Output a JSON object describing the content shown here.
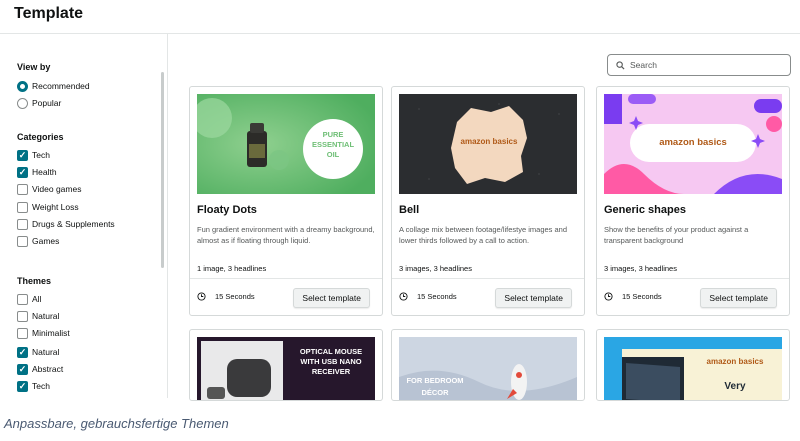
{
  "header": {
    "title": "Template"
  },
  "sidebar": {
    "view_by": {
      "heading": "View by",
      "options": [
        {
          "label": "Recommended",
          "selected": true
        },
        {
          "label": "Popular",
          "selected": false
        }
      ]
    },
    "categories": {
      "heading": "Categories",
      "items": [
        {
          "label": "Tech",
          "checked": true
        },
        {
          "label": "Health",
          "checked": true
        },
        {
          "label": "Video games",
          "checked": false
        },
        {
          "label": "Weight Loss",
          "checked": false
        },
        {
          "label": "Drugs & Supplements",
          "checked": false
        },
        {
          "label": "Games",
          "checked": false
        }
      ]
    },
    "themes": {
      "heading": "Themes",
      "items": [
        {
          "label": "All",
          "checked": false
        },
        {
          "label": "Natural",
          "checked": false
        },
        {
          "label": "Minimalist",
          "checked": false
        },
        {
          "label": "Natural",
          "checked": true
        },
        {
          "label": "Abstract",
          "checked": true
        },
        {
          "label": "Tech",
          "checked": true
        }
      ]
    }
  },
  "search": {
    "placeholder": "Search",
    "icon": "search-icon"
  },
  "cards": [
    {
      "title": "Floaty Dots",
      "description": "Fun gradient environment with a dreamy background, almost as if floating through liquid.",
      "meta": "1 image, 3 headlines",
      "duration": "15 Seconds",
      "button": "Select template",
      "thumb_text": [
        "PURE",
        "ESSENTIAL",
        "OIL"
      ]
    },
    {
      "title": "Bell",
      "description": "A collage mix between footage/lifestye images and lower thirds followed by a call to action.",
      "meta": "3 images, 3 headlines",
      "duration": "15 Seconds",
      "button": "Select template",
      "thumb_text": "amazon basics"
    },
    {
      "title": "Generic shapes",
      "description": "Show the benefits of your product against a transparent background",
      "meta": "3 images, 3 headlines",
      "duration": "15 Seconds",
      "button": "Select template",
      "thumb_text": "amazon basics"
    }
  ],
  "bottom_cards": [
    {
      "thumb_text": [
        "OPTICAL MOUSE",
        "WITH USB NANO",
        "RECEIVER"
      ]
    },
    {
      "thumb_text": [
        "FOR BEDROOM",
        "DÉCOR"
      ]
    },
    {
      "thumb_text": [
        "amazon basics",
        "Very"
      ]
    }
  ],
  "caption": "Anpassbare, gebrauchsfertige Themen",
  "colors": {
    "accent": "#007185",
    "title": "#0f1111",
    "caption": "#4a5a72"
  }
}
